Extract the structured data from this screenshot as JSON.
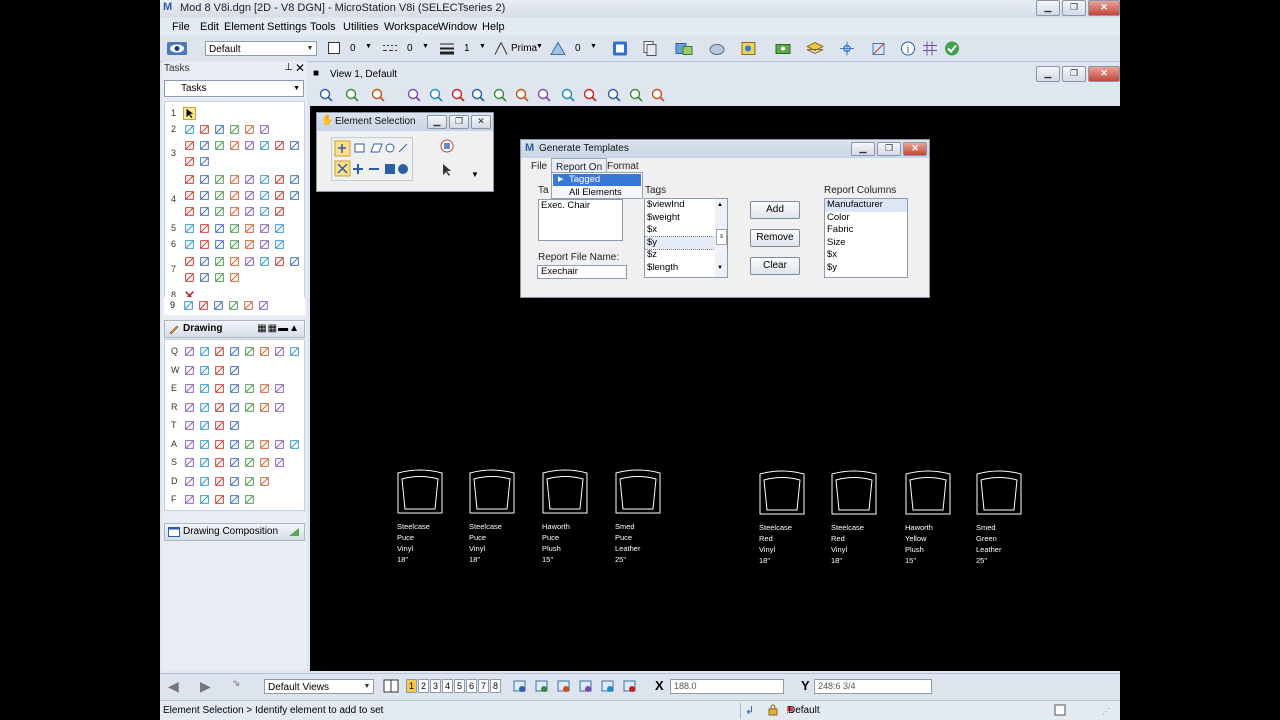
{
  "window": {
    "title": "Mod 8 V8i.dgn [2D - V8 DGN] - MicroStation V8i (SELECTseries 2)"
  },
  "menu": [
    "File",
    "Edit",
    "Element",
    "Settings",
    "Tools",
    "Utilities",
    "Workspace",
    "Window",
    "Help"
  ],
  "attributes": {
    "level": "Default",
    "color": "0",
    "style": "0",
    "weight": "1",
    "class": "Prima",
    "transparency": "0"
  },
  "tasks": {
    "header": "Tasks",
    "selected": "Tasks",
    "row_numbers": [
      "1",
      "2",
      "3",
      "4",
      "5",
      "6",
      "7",
      "8",
      "9"
    ],
    "drawing_title": "Drawing",
    "drawing_rows": [
      "Q",
      "W",
      "E",
      "R",
      "T",
      "A",
      "S",
      "D",
      "F"
    ],
    "drawing_composition": "Drawing Composition"
  },
  "view": {
    "title": "View 1, Default"
  },
  "element_selection": {
    "title": "Element Selection"
  },
  "generate_templates": {
    "title": "Generate Templates",
    "menu": [
      "File",
      "Report On",
      "Format"
    ],
    "dropdown": [
      "Tagged Elements",
      "All Elements"
    ],
    "tag_sets_label": "Ta",
    "tag_sets": [
      "Exec. Chair"
    ],
    "tags_label": "Tags",
    "tags": [
      "$viewInd",
      "$weight",
      "$x",
      "$y",
      "$z",
      "$length"
    ],
    "selected_tag": "$y",
    "report_columns_label": "Report Columns",
    "report_columns": [
      "Manufacturer",
      "Color",
      "Fabric",
      "Size",
      "$x",
      "$y"
    ],
    "selected_column": "Manufacturer",
    "buttons": {
      "add": "Add",
      "remove": "Remove",
      "clear": "Clear"
    },
    "report_file_label": "Report File Name:",
    "report_file_value": "Exechair"
  },
  "chairs": [
    [
      "Steelcase",
      "Puce",
      "Vinyl",
      "18\""
    ],
    [
      "Steelcase",
      "Puce",
      "Vinyl",
      "18\""
    ],
    [
      "Haworth",
      "Puce",
      "Plush",
      "15\""
    ],
    [
      "Smed",
      "Puce",
      "Leather",
      "25\""
    ],
    [
      "Steelcase",
      "Red",
      "Vinyl",
      "18\""
    ],
    [
      "Steelcase",
      "Red",
      "Vinyl",
      "18\""
    ],
    [
      "Haworth",
      "Yellow",
      "Plush",
      "15\""
    ],
    [
      "Smed",
      "Green",
      "Leather",
      "25\""
    ]
  ],
  "bottom": {
    "views": "Default Views",
    "view_numbers": [
      "1",
      "2",
      "3",
      "4",
      "5",
      "6",
      "7",
      "8"
    ],
    "x_label": "X",
    "x_value": "188.0",
    "y_label": "Y",
    "y_value": "248:6 3/4"
  },
  "status": {
    "prompt": "Element Selection > Identify element to add to set",
    "level": "Default"
  }
}
